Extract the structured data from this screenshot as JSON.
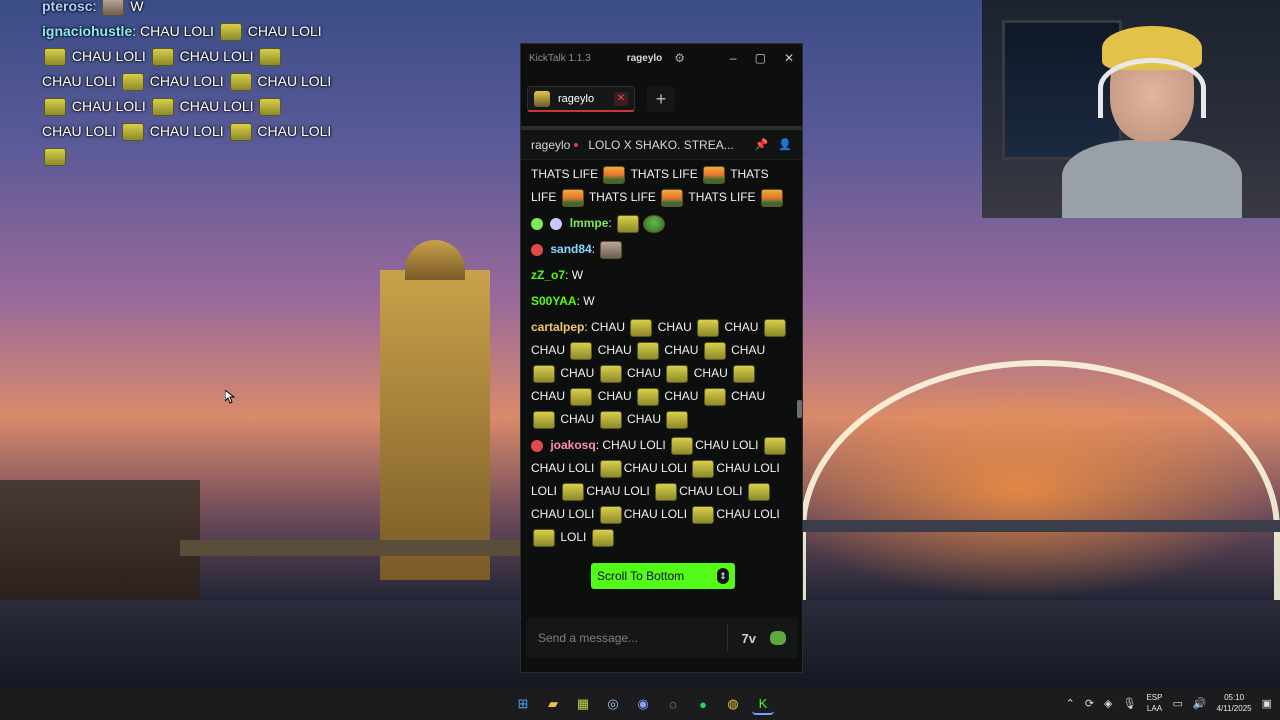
{
  "overlay_chat": {
    "line0_user": "pterosc",
    "line0_text": "W",
    "line1_user": "ignaciohustle",
    "line1_text": "CHAU LOLI",
    "rows": [
      "CHAU LOLI",
      "CHAU LOLI",
      "CHAU LOLI",
      "CHAU LOLI",
      "CHAU LOLI",
      "CHAU LOLI",
      "CHAU LOLI",
      "CHAU LOLI",
      "CHAU LOLI",
      "CHAU LOLI",
      "CHAU LOLI",
      "CHAU LOLI",
      "CHAU LOLI"
    ]
  },
  "kicktalk": {
    "app_title": "KickTalk 1.1.3",
    "channel_chip": "rageylo",
    "tab_label": "rageylo",
    "add_tab": "+",
    "stream_channel": "rageylo",
    "stream_title": "LOLO X SHAKO. STREA...",
    "input_placeholder": "Send a message...",
    "scroll_to_bottom": "Scroll To Bottom",
    "messages": {
      "thatslife": "THATS LIFE",
      "lmmpe_user": "lmmpe",
      "sand_user": "sand84",
      "zz_user": "zZ_o7",
      "zz_text": "W",
      "sooyaa_user": "S00YAA",
      "sooyaa_text": "W",
      "cartal_user": "cartalpep",
      "chau": "CHAU",
      "joako_user": "joakosq",
      "chau_loli": "CHAU LOLI",
      "loli": "LOLI"
    }
  },
  "taskbar": {
    "lang_top": "ESP",
    "lang_bottom": "LAA",
    "time": "05:10",
    "date": "4/11/2025"
  },
  "colors": {
    "kick_green": "#53fc18",
    "tab_accent": "#c43a3a",
    "cartal_user": "#f0c86a",
    "lmmpe_user": "#7ee85a",
    "sand_user": "#8ad7ff",
    "zz_user": "#53fc18",
    "sooyaa_user": "#53fc18",
    "joako_user": "#ff8fb0"
  }
}
